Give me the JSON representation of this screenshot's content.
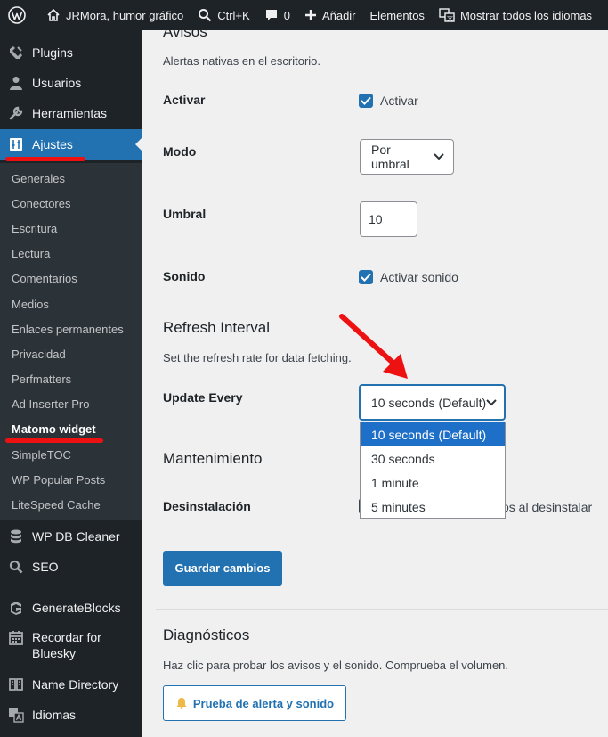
{
  "admin_bar": {
    "site_name": "JRMora, humor gráfico",
    "shortcut": "Ctrl+K",
    "comments_count": "0",
    "add_new": "Añadir",
    "elements": "Elementos",
    "languages": "Mostrar todos los idiomas"
  },
  "sidebar": {
    "plugins": "Plugins",
    "users": "Usuarios",
    "tools": "Herramientas",
    "settings": "Ajustes",
    "submenu": [
      "Generales",
      "Conectores",
      "Escritura",
      "Lectura",
      "Comentarios",
      "Medios",
      "Enlaces permanentes",
      "Privacidad",
      "Perfmatters",
      "Ad Inserter Pro",
      "Matomo widget",
      "SimpleTOC",
      "WP Popular Posts",
      "LiteSpeed Cache"
    ],
    "wp_db_cleaner": "WP DB Cleaner",
    "seo": "SEO",
    "generateblocks": "GenerateBlocks",
    "bluesky": "Recordar for Bluesky",
    "name_directory": "Name Directory",
    "languages": "Idiomas"
  },
  "content": {
    "avisos_heading": "Avisos",
    "avisos_desc": "Alertas nativas en el escritorio.",
    "activar_label": "Activar",
    "activar_checkbox": "Activar",
    "modo_label": "Modo",
    "modo_value": "Por umbral",
    "umbral_label": "Umbral",
    "umbral_value": "10",
    "sonido_label": "Sonido",
    "sonido_checkbox": "Activar sonido",
    "refresh_heading": "Refresh Interval",
    "refresh_desc": "Set the refresh rate for data fetching.",
    "update_label": "Update Every",
    "update_value": "10 seconds (Default)",
    "update_options": [
      "10 seconds (Default)",
      "30 seconds",
      "1 minute",
      "5 minutes"
    ],
    "maint_heading": "Mantenimiento",
    "desinst_label": "Desinstalación",
    "desinst_checkbox_tail": "os al desinstalar",
    "save_button": "Guardar cambios",
    "diag_heading": "Diagnósticos",
    "diag_desc": "Haz clic para probar los avisos y el sonido. Comprueba el volumen.",
    "diag_button": "Prueba de alerta y sonido"
  },
  "colors": {
    "admin_bar_bg": "#1d2327",
    "accent": "#2271b1",
    "annotation_red": "#ee1111"
  }
}
